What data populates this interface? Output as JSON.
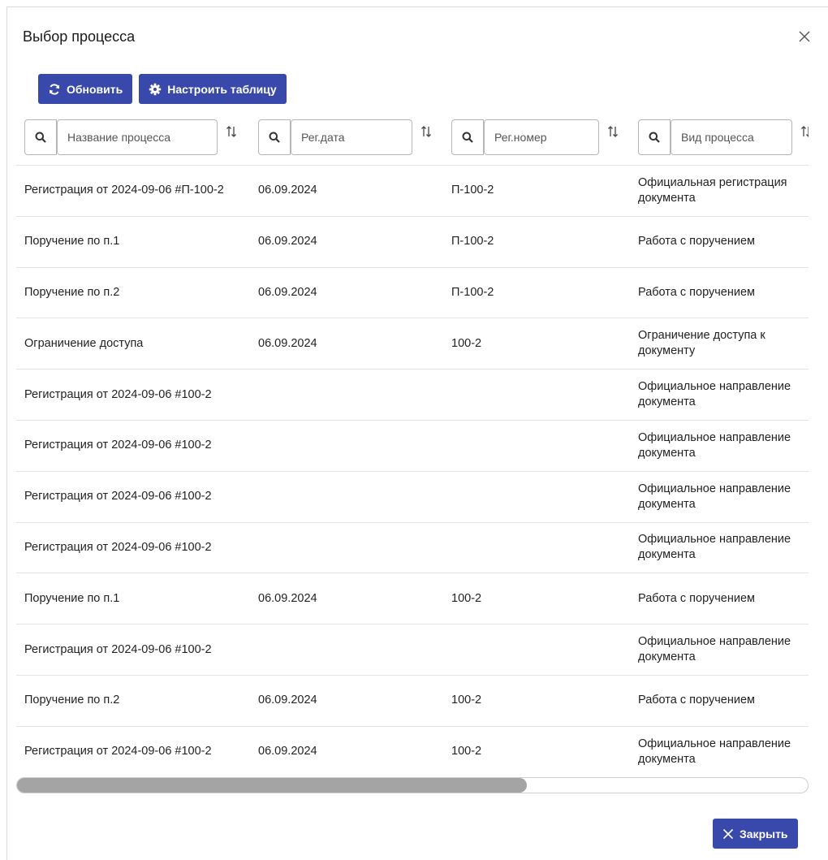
{
  "dialog": {
    "title": "Выбор процесса",
    "close_icon": "close-icon"
  },
  "toolbar": {
    "refresh_label": "Обновить",
    "refresh_icon": "refresh-icon",
    "configure_label": "Настроить таблицу",
    "configure_icon": "gear-icon"
  },
  "filters": [
    {
      "placeholder": "Название процесса"
    },
    {
      "placeholder": "Рег.дата"
    },
    {
      "placeholder": "Рег.номер"
    },
    {
      "placeholder": "Вид процесса"
    }
  ],
  "rows": [
    {
      "name": "Регистрация от 2024-09-06 #П-100-2",
      "date": "06.09.2024",
      "number": "П-100-2",
      "kind": "Официальная регистрация документа"
    },
    {
      "name": "Поручение по п.1",
      "date": "06.09.2024",
      "number": "П-100-2",
      "kind": "Работа с поручением"
    },
    {
      "name": "Поручение по п.2",
      "date": "06.09.2024",
      "number": "П-100-2",
      "kind": "Работа с поручением"
    },
    {
      "name": "Ограничение доступа",
      "date": "06.09.2024",
      "number": "100-2",
      "kind": "Ограничение доступа к документу"
    },
    {
      "name": "Регистрация от 2024-09-06 #100-2",
      "date": "",
      "number": "",
      "kind": "Официальное направление документа"
    },
    {
      "name": "Регистрация от 2024-09-06 #100-2",
      "date": "",
      "number": "",
      "kind": "Официальное направление документа"
    },
    {
      "name": "Регистрация от 2024-09-06 #100-2",
      "date": "",
      "number": "",
      "kind": "Официальное направление документа"
    },
    {
      "name": "Регистрация от 2024-09-06 #100-2",
      "date": "",
      "number": "",
      "kind": "Официальное направление документа"
    },
    {
      "name": "Поручение по п.1",
      "date": "06.09.2024",
      "number": "100-2",
      "kind": "Работа с поручением"
    },
    {
      "name": "Регистрация от 2024-09-06 #100-2",
      "date": "",
      "number": "",
      "kind": "Официальное направление документа"
    },
    {
      "name": "Поручение по п.2",
      "date": "06.09.2024",
      "number": "100-2",
      "kind": "Работа с поручением"
    },
    {
      "name": "Регистрация от 2024-09-06 #100-2",
      "date": "06.09.2024",
      "number": "100-2",
      "kind": "Официальное направление документа"
    }
  ],
  "footer": {
    "close_label": "Закрыть",
    "close_icon": "close-icon"
  },
  "colors": {
    "primary": "#3949ab",
    "border": "#b5b5b5",
    "scroll_thumb": "#a4a4a4"
  }
}
